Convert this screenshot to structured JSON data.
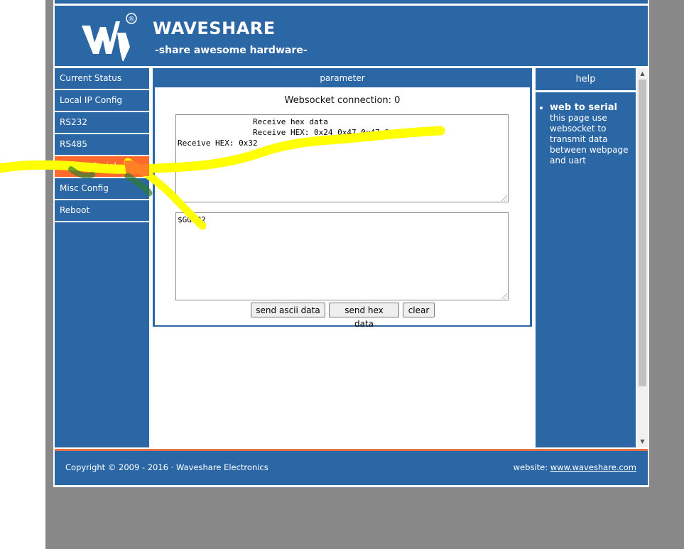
{
  "brand": {
    "name": "WAVESHARE",
    "tagline": "-share awesome hardware-",
    "logo_mark": "®"
  },
  "nav": {
    "items": [
      {
        "label": "Current Status"
      },
      {
        "label": "Local IP Config"
      },
      {
        "label": "RS232"
      },
      {
        "label": "RS485"
      },
      {
        "label": "Web to Serial",
        "active": true
      },
      {
        "label": "Misc Config"
      },
      {
        "label": "Reboot"
      }
    ]
  },
  "parameter": {
    "title": "parameter",
    "ws_status": "Websocket connection: 0",
    "receive_text": "                Receive hex data\n                Receive HEX: 0x24 0x47 0x47 0x2a 0x42\nReceive HEX: 0x32",
    "send_text": "$GG*B2",
    "buttons": {
      "ascii": "send ascii data",
      "hex": "send hex data",
      "clear": "clear"
    }
  },
  "help": {
    "title": "help",
    "item_title": "web to serial",
    "item_text": "this page use websocket to transmit data between webpage and uart"
  },
  "footer": {
    "copyright": "Copyright © 2009 - 2016 · Waveshare Electronics",
    "website_label": "website:",
    "website_link": "www.waveshare.com"
  },
  "colors": {
    "primary": "#2b66a5",
    "active": "#ff6a2b",
    "highlight": "#ffff00",
    "page_bg": "#888888"
  },
  "icons": {
    "logo": "waveshare-logo-icon",
    "scroll_up": "arrow-up-icon",
    "scroll_down": "arrow-down-icon"
  }
}
